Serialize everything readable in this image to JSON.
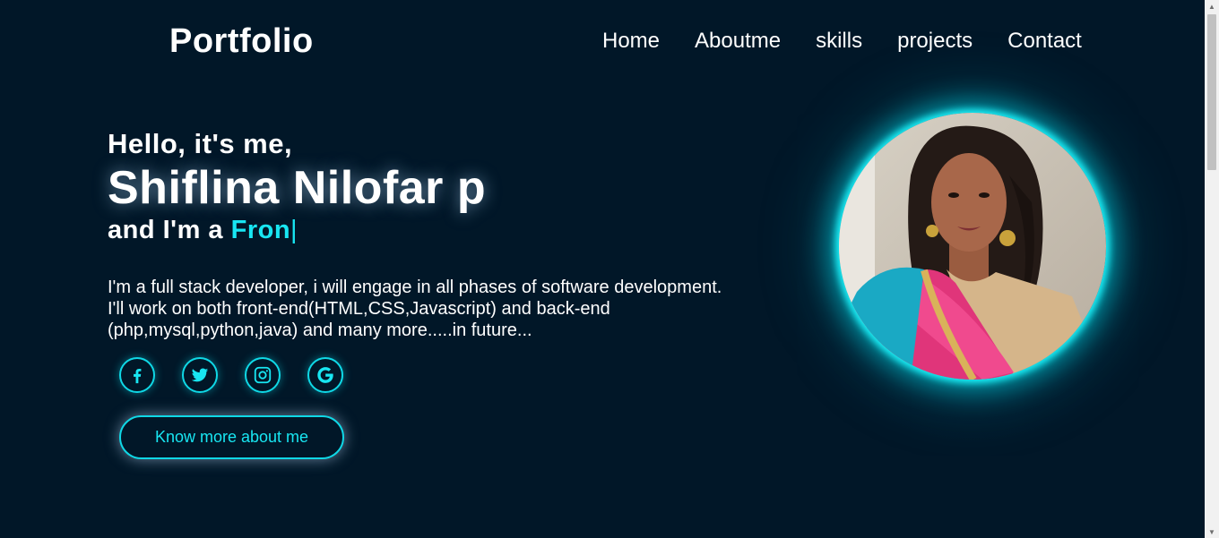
{
  "header": {
    "logo": "Portfolio",
    "nav": [
      "Home",
      "Aboutme",
      "skills",
      "projects",
      "Contact"
    ]
  },
  "hero": {
    "greeting": "Hello, it's me,",
    "name": "Shiflina Nilofar p",
    "role_prefix": "and I'm a ",
    "role_typed": "Fron",
    "cursor": "|",
    "about": "I'm a full stack developer, i will engage in all phases of software development. I'll work on both front-end(HTML,CSS,Javascript) and back-end (php,mysql,python,java) and many more.....in future...",
    "socials": [
      "facebook-icon",
      "twitter-icon",
      "instagram-icon",
      "google-icon"
    ],
    "cta_label": "Know more about me"
  },
  "colors": {
    "background": "#011728",
    "accent": "#18e6f2",
    "text": "#ffffff"
  }
}
